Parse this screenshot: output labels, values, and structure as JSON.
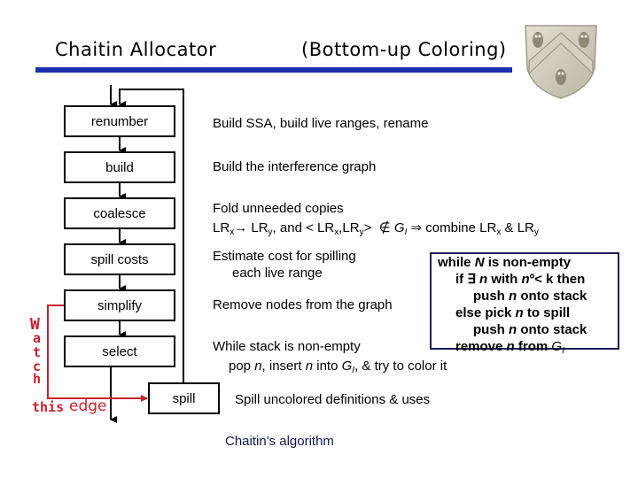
{
  "header": {
    "title_left": "Chaitin Allocator",
    "title_right": "(Bottom-up Coloring)",
    "rule_color": "#1a2fb0",
    "logo": "shield-logo"
  },
  "flow": {
    "boxes": [
      {
        "label": "renumber"
      },
      {
        "label": "build"
      },
      {
        "label": "coalesce"
      },
      {
        "label": "spill costs"
      },
      {
        "label": "simplify"
      },
      {
        "label": "select"
      }
    ],
    "spill_box": {
      "label": "spill"
    }
  },
  "descriptions": {
    "renumber": "Build SSA, build live ranges, rename",
    "build": "Build the interference graph",
    "coalesce_line1": "Fold unneeded copies",
    "coalesce_line2": {
      "lr": "LR",
      "x": "x",
      "y": "y",
      "arrow": "→",
      "and": ", and <",
      "comma": ",",
      "close": ">",
      "notin": "∉",
      "G": "G",
      "I": "I",
      "implies": "⇒",
      "combine": "combine",
      "amp": "&"
    },
    "spill_costs_line1": "Estimate cost for spilling",
    "spill_costs_line2": "each live range",
    "simplify": "Remove nodes from the graph",
    "select_line1": "While stack is non-empty",
    "select_line2": {
      "pop": "pop",
      "n": "n",
      "insert": ", insert",
      "into": "into",
      "G": "G",
      "I": "I",
      "rest": ", & try to color it"
    },
    "spill": "Spill uncolored definitions & uses"
  },
  "algorithm_box": {
    "line1": {
      "a": "while ",
      "N": "N",
      "b": " is non-empty"
    },
    "line2": {
      "a": "if ∃ ",
      "n": "n",
      "b": " with ",
      "n2": "n",
      "c": "º< k then"
    },
    "line3": {
      "a": "push ",
      "n": "n",
      "b": " onto stack"
    },
    "line4": {
      "a": "else pick ",
      "n": "n",
      "b": " to spill"
    },
    "line5": {
      "a": "push ",
      "n": "n",
      "b": " onto stack"
    },
    "line6": {
      "a": "remove ",
      "n": "n",
      "b": "  from ",
      "G": "G",
      "I": "I"
    },
    "border_color": "#1c1c5c"
  },
  "annotation": {
    "letters": [
      "W",
      "a",
      "t",
      "c",
      "h"
    ],
    "this": "this",
    "edge": "edge",
    "color": "#c8202e"
  },
  "caption": "Chaitin's algorithm"
}
